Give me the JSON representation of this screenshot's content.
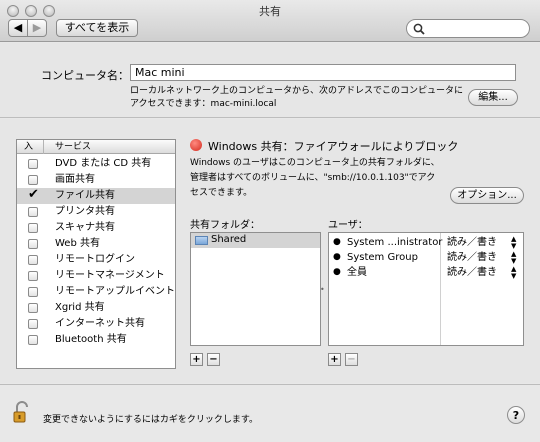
{
  "window": {
    "title": "共有"
  },
  "toolbar": {
    "show_all_label": "すべてを表示",
    "search_placeholder": ""
  },
  "computer": {
    "label": "コンピュータ名：",
    "name_value": "Mac mini",
    "description": "ローカルネットワーク上のコンピュータから、次のアドレスでこのコンピュータに\nアクセスできます：mac-mini.local",
    "edit_label": "編集..."
  },
  "services": {
    "header_on": "入",
    "header_service": "サービス",
    "items": [
      {
        "label": "DVD または CD 共有",
        "checked": false
      },
      {
        "label": "画面共有",
        "checked": false
      },
      {
        "label": "ファイル共有",
        "checked": true
      },
      {
        "label": "プリンタ共有",
        "checked": false
      },
      {
        "label": "スキャナ共有",
        "checked": false
      },
      {
        "label": "Web 共有",
        "checked": false
      },
      {
        "label": "リモートログイン",
        "checked": false
      },
      {
        "label": "リモートマネージメント",
        "checked": false
      },
      {
        "label": "リモートアップルイベント",
        "checked": false
      },
      {
        "label": "Xgrid 共有",
        "checked": false
      },
      {
        "label": "インターネット共有",
        "checked": false
      },
      {
        "label": "Bluetooth 共有",
        "checked": false
      }
    ]
  },
  "status": {
    "text": "Windows 共有：ファイアウォールによりブロック",
    "indicator_color": "#d42a1e",
    "description": "Windows のユーザはこのコンピュータ上の共有フォルダに、\n管理者はすべてのボリュームに、\"smb://10.0.1.103\"でアク\nセスできます。",
    "options_label": "オプション..."
  },
  "shared_folders": {
    "label": "共有フォルダ：",
    "items": [
      "Shared"
    ]
  },
  "users": {
    "label": "ユーザ：",
    "items": [
      {
        "name": "System ...inistrator",
        "icon": "user-icon",
        "permission": "読み／書き"
      },
      {
        "name": "System Group",
        "icon": "group-icon",
        "permission": "読み／書き"
      },
      {
        "name": "全員",
        "icon": "everyone-icon",
        "permission": "読み／書き"
      }
    ]
  },
  "buttons": {
    "add": "+",
    "remove": "−"
  },
  "footer": {
    "lock_text": "変更できないようにするにはカギをクリックします。",
    "help_label": "?"
  }
}
